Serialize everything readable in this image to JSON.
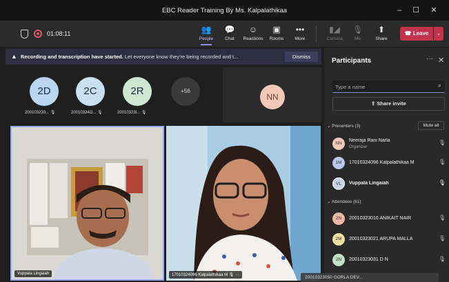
{
  "window": {
    "title": "EBC Reader Training By Ms. Kalpalathikaa",
    "minimize": "–",
    "maximize": "☐",
    "close": "✕"
  },
  "toolbar": {
    "timer": "01:08:11",
    "items": [
      {
        "label": "People",
        "icon": "people-icon",
        "glyph": "👥"
      },
      {
        "label": "Chat",
        "icon": "chat-icon",
        "glyph": "💬"
      },
      {
        "label": "Reactions",
        "icon": "reactions-icon",
        "glyph": "☺"
      },
      {
        "label": "Rooms",
        "icon": "rooms-icon",
        "glyph": "▣"
      },
      {
        "label": "More",
        "icon": "more-icon",
        "glyph": "•••"
      },
      {
        "label": "Camera",
        "icon": "camera-off-icon",
        "glyph": "▮◢"
      },
      {
        "label": "Mic",
        "icon": "mic-off-icon",
        "glyph": "🎙"
      },
      {
        "label": "Share",
        "icon": "share-icon",
        "glyph": "⬆"
      }
    ],
    "leave_label": "Leave",
    "leave_icon": "☎",
    "leave_dropdown": "⌄"
  },
  "banner": {
    "icon": "▲",
    "bold_text": "Recording and transcription have started.",
    "text": "Let everyone know they're being recorded and t...",
    "dismiss_label": "Dismiss"
  },
  "strip": {
    "avatars": [
      {
        "initials": "2D",
        "name": "200103230...",
        "color": "#b9d7f0"
      },
      {
        "initials": "2C",
        "name": "20010324O...",
        "color": "#c9dff2"
      },
      {
        "initials": "2R",
        "name": "20010323l...",
        "color": "#cfe6d3"
      }
    ],
    "more_count": "+56",
    "spotlight_initials": "NN"
  },
  "videos": [
    {
      "name": "Vuppala Lingaiah"
    },
    {
      "name": "17010324096 Kalpalathikaa M"
    }
  ],
  "participants": {
    "title": "Participants",
    "more": "···",
    "close": "✕",
    "search_placeholder": "Type a name",
    "share_invite_label": "Share invite",
    "presenters_label": "Presenters (3)",
    "mute_all_label": "Mute all",
    "presenters": [
      {
        "initials": "NN",
        "name": "Neeraja Rani Narla",
        "role": "Organizer",
        "color": "#f3c9b7"
      },
      {
        "initials": "1M",
        "name": "17010324096 Kalpalathikaa M",
        "role": "",
        "color": "#b9c9f0"
      },
      {
        "initials": "VL",
        "name": "Vuppala Lingaiah",
        "role": "",
        "color": "#c9d2e6"
      }
    ],
    "attendees_label": "Attendees (61)",
    "attendees": [
      {
        "initials": "2N",
        "name": "20010323016 ANIKAIT NAIR",
        "color": "#f0b7a9"
      },
      {
        "initials": "2M",
        "name": "20010323021 ARUPA MALLA",
        "color": "#efe0a1"
      },
      {
        "initials": "2N",
        "name": "20010323031 D N",
        "color": "#c2e2c8"
      }
    ],
    "tooltip": "20010323050 GORLA DEV..."
  }
}
